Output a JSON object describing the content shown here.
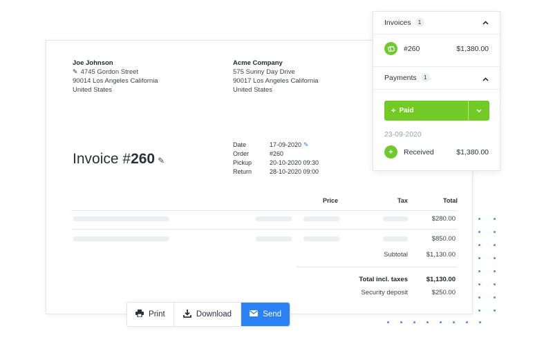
{
  "invoice": {
    "from": {
      "name": "Joe Johnson",
      "street": "4745 Gordon Street",
      "city": "90014 Los Angeles California",
      "country": "United States"
    },
    "to": {
      "name": "Acme Company",
      "street": "575 Sunny Day Drive",
      "city": "90017 Los Angeles California",
      "country": "United States"
    },
    "title_prefix": "Invoice #",
    "number": "260",
    "meta": [
      {
        "label": "Date",
        "value": "17-09-2020"
      },
      {
        "label": "Order",
        "value": "#260"
      },
      {
        "label": "Pickup",
        "value": "20-10-2020 09:30"
      },
      {
        "label": "Return",
        "value": "28-10-2020 09:00"
      }
    ],
    "table": {
      "headers": {
        "price": "Price",
        "tax": "Tax",
        "total": "Total"
      },
      "rows": [
        {
          "total": "$280.00"
        },
        {
          "total": "$850.00"
        }
      ],
      "subtotal_label": "Subtotal",
      "subtotal_value": "$1,130.00",
      "total_label": "Total incl. taxes",
      "total_value": "$1,130.00",
      "deposit_label": "Security deposit",
      "deposit_value": "$250.00"
    }
  },
  "actions": {
    "print": "Print",
    "download": "Download",
    "send": "Send"
  },
  "panel": {
    "invoices": {
      "title": "Invoices",
      "count": "1",
      "item_number": "#260",
      "item_amount": "$1,380.00"
    },
    "payments": {
      "title": "Payments",
      "count": "1",
      "paid_label": "Paid",
      "date": "23-09-2020",
      "received_label": "Received",
      "received_amount": "$1,380.00"
    }
  },
  "colors": {
    "accent_blue": "#2c81f5",
    "accent_green": "#72cb24",
    "dot_blue": "#4d8ef0"
  }
}
